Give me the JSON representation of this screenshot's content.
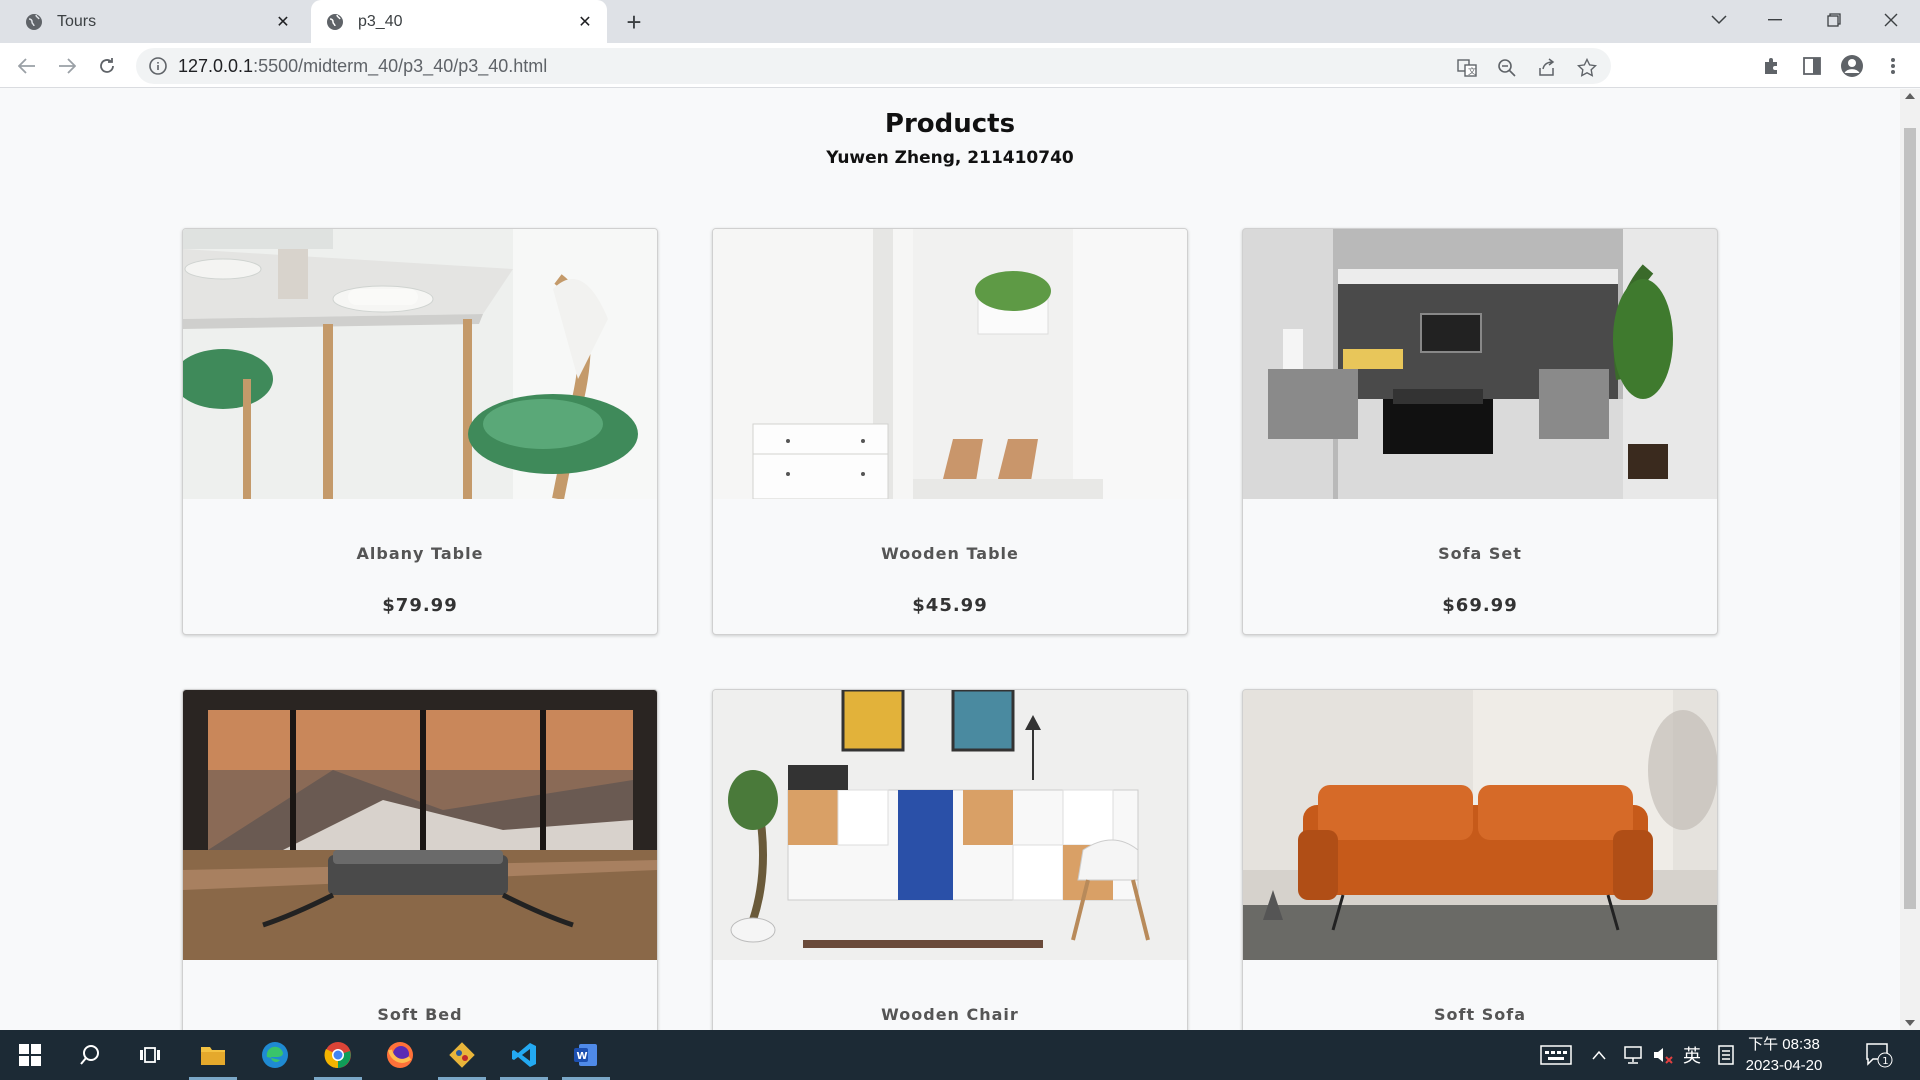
{
  "browser": {
    "tabs": [
      {
        "title": "Tours",
        "active": false
      },
      {
        "title": "p3_40",
        "active": true
      }
    ],
    "url_host": "127.0.0.1",
    "url_path": ":5500/midterm_40/p3_40/p3_40.html"
  },
  "page": {
    "title": "Products",
    "subtitle": "Yuwen Zheng, 211410740"
  },
  "products": [
    {
      "name": "Albany Table",
      "price": "$79.99"
    },
    {
      "name": "Wooden Table",
      "price": "$45.99"
    },
    {
      "name": "Sofa Set",
      "price": "$69.99"
    },
    {
      "name": "Soft Bed",
      "price": ""
    },
    {
      "name": "Wooden Chair",
      "price": ""
    },
    {
      "name": "Soft Sofa",
      "price": ""
    }
  ],
  "taskbar": {
    "clock_time": "下午 08:38",
    "clock_date": "2023-04-20",
    "ime": "英",
    "notifications": "1"
  }
}
